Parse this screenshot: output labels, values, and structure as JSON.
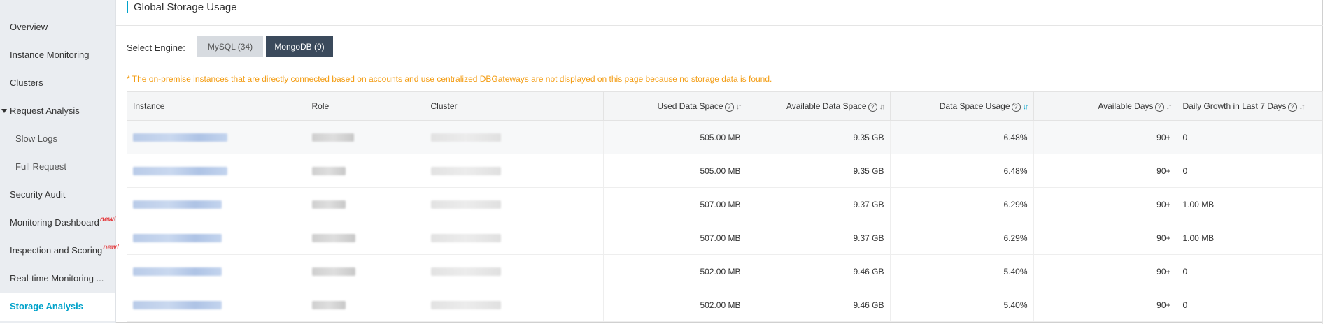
{
  "sidebar": {
    "items": [
      {
        "label": "Overview"
      },
      {
        "label": "Instance Monitoring"
      },
      {
        "label": "Clusters"
      },
      {
        "label": "Request Analysis"
      },
      {
        "label": "Slow Logs"
      },
      {
        "label": "Full Request"
      },
      {
        "label": "Security Audit"
      },
      {
        "label": "Monitoring Dashboard",
        "badge": "new!"
      },
      {
        "label": "Inspection and Scoring",
        "badge": "new!"
      },
      {
        "label": "Real-time Monitoring ..."
      },
      {
        "label": "Storage Analysis"
      }
    ]
  },
  "page": {
    "title": "Global Storage Usage",
    "engine_label": "Select Engine:",
    "engines": [
      {
        "label": "MySQL (34)",
        "selected": false
      },
      {
        "label": "MongoDB (9)",
        "selected": true
      }
    ],
    "notice": "* The on-premise instances that are directly connected based on accounts and use centralized DBGateways are not displayed on this page because no storage data is found."
  },
  "table": {
    "columns": [
      {
        "label": "Instance"
      },
      {
        "label": "Role"
      },
      {
        "label": "Cluster"
      },
      {
        "label": "Used Data Space"
      },
      {
        "label": "Available Data Space"
      },
      {
        "label": "Data Space Usage"
      },
      {
        "label": "Available Days"
      },
      {
        "label": "Daily Growth in Last 7 Days"
      }
    ],
    "rows": [
      {
        "used": "505.00 MB",
        "available": "9.35 GB",
        "usage": "6.48%",
        "days": "90+",
        "growth": "0"
      },
      {
        "used": "505.00 MB",
        "available": "9.35 GB",
        "usage": "6.48%",
        "days": "90+",
        "growth": "0"
      },
      {
        "used": "507.00 MB",
        "available": "9.37 GB",
        "usage": "6.29%",
        "days": "90+",
        "growth": "1.00 MB"
      },
      {
        "used": "507.00 MB",
        "available": "9.37 GB",
        "usage": "6.29%",
        "days": "90+",
        "growth": "1.00 MB"
      },
      {
        "used": "502.00 MB",
        "available": "9.46 GB",
        "usage": "5.40%",
        "days": "90+",
        "growth": "0"
      },
      {
        "used": "502.00 MB",
        "available": "9.46 GB",
        "usage": "5.40%",
        "days": "90+",
        "growth": "0"
      }
    ]
  },
  "colors": {
    "accent": "#00a2ca",
    "selected_engine_bg": "#3b4a5c",
    "notice": "#f39c12",
    "badge": "#e4393c"
  }
}
